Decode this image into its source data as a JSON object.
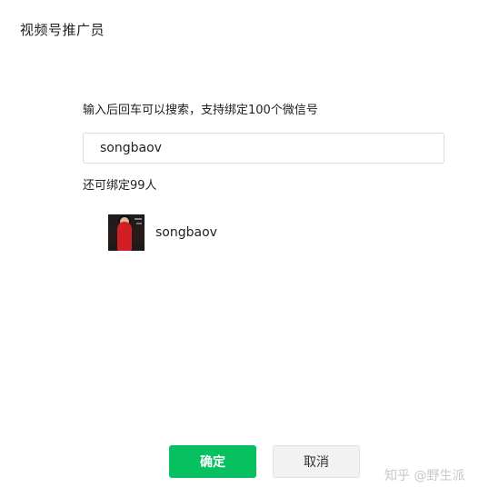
{
  "dialog": {
    "title": "视频号推广员",
    "hint": "输入后回车可以搜索，支持绑定100个微信号",
    "search": {
      "value": "songbaov"
    },
    "remaining": "还可绑定99人",
    "results": [
      {
        "username": "songbaov"
      }
    ],
    "buttons": {
      "confirm": "确定",
      "cancel": "取消"
    }
  },
  "watermark": "知乎 @野生派",
  "colors": {
    "confirm_bg": "#07c160",
    "cancel_bg": "#f2f2f2"
  }
}
